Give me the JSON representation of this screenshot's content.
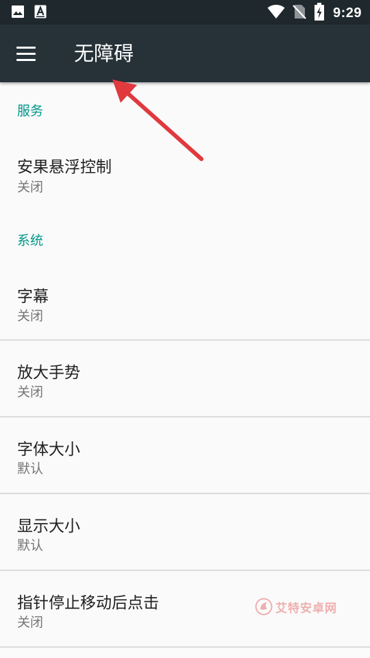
{
  "status_bar": {
    "time": "9:29",
    "left_icons": [
      "image-icon",
      "text-a-icon"
    ],
    "right_icons": [
      "wifi-icon",
      "no-sim-icon",
      "battery-charging-icon"
    ]
  },
  "toolbar": {
    "title": "无障碍",
    "menu_icon": "hamburger-menu-icon"
  },
  "categories": {
    "services": "服务",
    "system": "系统"
  },
  "items": [
    {
      "title": "安果悬浮控制",
      "summary": "关闭"
    },
    {
      "title": "字幕",
      "summary": "关闭"
    },
    {
      "title": "放大手势",
      "summary": "关闭"
    },
    {
      "title": "字体大小",
      "summary": "默认"
    },
    {
      "title": "显示大小",
      "summary": "默认"
    },
    {
      "title": "指针停止移动后点击",
      "summary": "关闭"
    }
  ],
  "watermark": {
    "text": "艾特安卓网"
  },
  "colors": {
    "status_bar": "#1f282c",
    "toolbar": "#263238",
    "accent": "#009688",
    "annotation_arrow": "#e0393e"
  }
}
